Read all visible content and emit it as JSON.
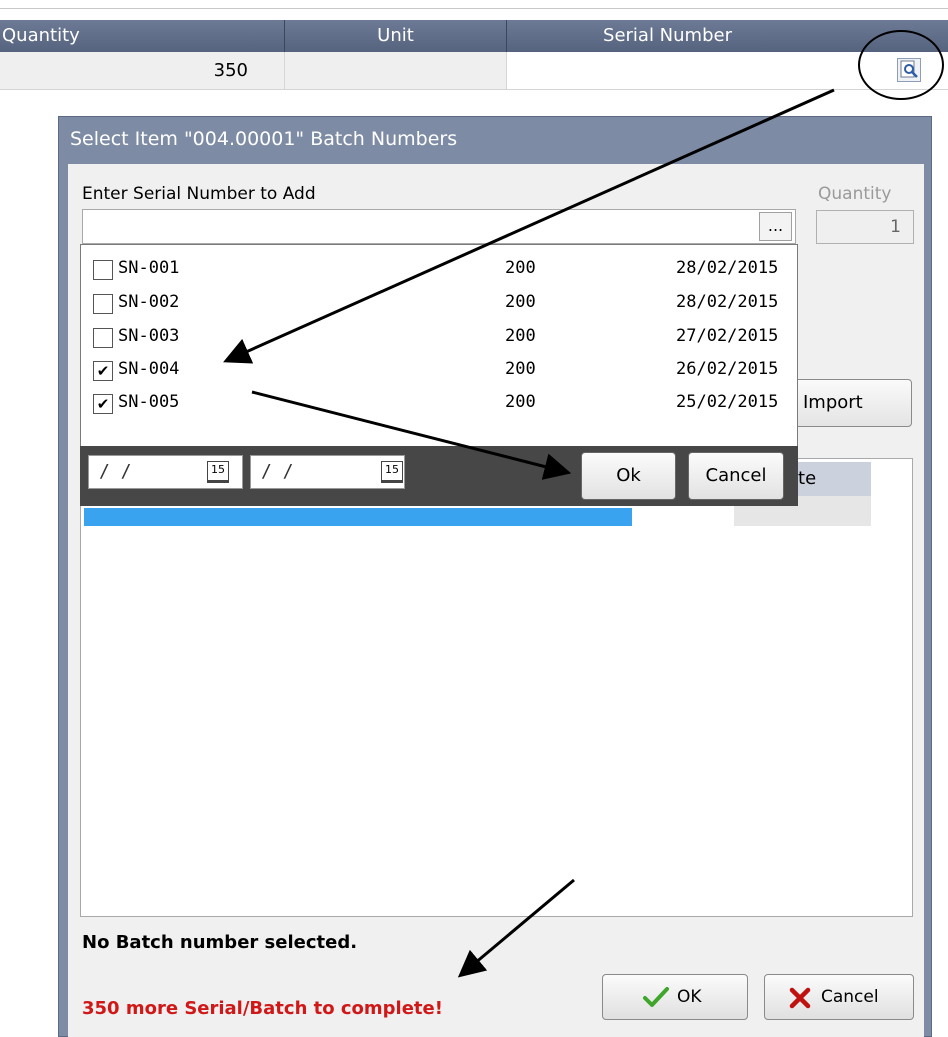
{
  "grid": {
    "headers": {
      "quantity": "Quantity",
      "unit": "Unit",
      "serial_number": "Serial Number"
    },
    "row": {
      "quantity": "350",
      "unit": "",
      "serial_number": ""
    }
  },
  "dialog": {
    "title": "Select Item \"004.00001\" Batch Numbers",
    "enter_label": "Enter Serial Number to Add",
    "serial_input_value": "",
    "browse_label": "...",
    "quantity_label": "Quantity",
    "quantity_value": "1",
    "import_label": "Import",
    "list_header_date": "d Date",
    "status_selected": "No Batch number selected.",
    "status_remaining": "350 more Serial/Batch to complete!",
    "ok_label": "OK",
    "cancel_label": "Cancel"
  },
  "popup": {
    "rows": [
      {
        "checked": false,
        "serial": "SN-001",
        "qty": "200",
        "date": "28/02/2015"
      },
      {
        "checked": false,
        "serial": "SN-002",
        "qty": "200",
        "date": "28/02/2015"
      },
      {
        "checked": false,
        "serial": "SN-003",
        "qty": "200",
        "date": "27/02/2015"
      },
      {
        "checked": true,
        "serial": "SN-004",
        "qty": "200",
        "date": "26/02/2015"
      },
      {
        "checked": true,
        "serial": "SN-005",
        "qty": "200",
        "date": "25/02/2015"
      }
    ],
    "date_from": "/ /",
    "date_to": "/ /",
    "calendar_glyph": "15",
    "ok_label": "Ok",
    "cancel_label": "Cancel"
  },
  "colors": {
    "header": "#5e6b86",
    "dialog_frame": "#7d8ba4",
    "accent_blue": "#3aa3f0",
    "error_red": "#d01818",
    "ok_green": "#3fa62b",
    "cancel_red": "#c01010"
  },
  "icons": [
    "lookup-icon",
    "calendar-icon",
    "checkmark-icon",
    "x-icon",
    "checkbox-icon"
  ]
}
